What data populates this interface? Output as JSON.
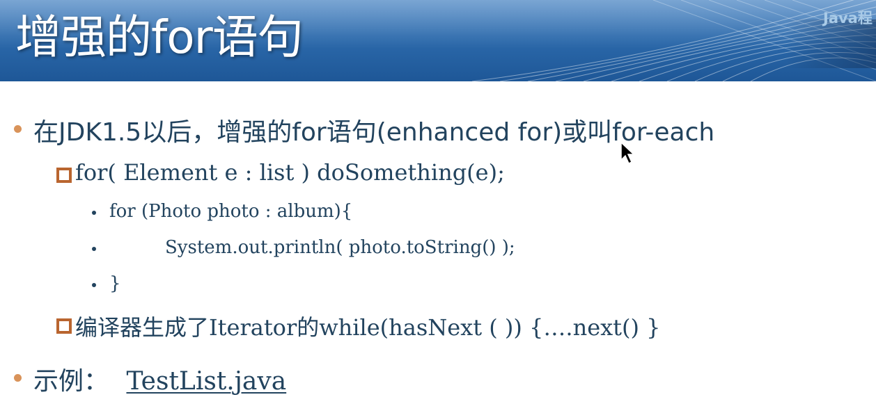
{
  "header": {
    "title": "增强的for语句",
    "brand": "Java程"
  },
  "slide": {
    "bullet1": "在JDK1.5以后，增强的for语句(enhanced for)或叫for-each",
    "sub1": "for( Element e :  list ) doSomething(e);",
    "code_lines": [
      "for (Photo photo : album){",
      "System.out.println( photo.toString() );",
      "}"
    ],
    "sub2": "编译器生成了Iterator的while(hasNext ( )) {….next() }",
    "bullet2_label": "示例：",
    "bullet2_link": "TestList.java"
  },
  "colors": {
    "header_blue": "#2c6aac",
    "text": "#22435e",
    "bullet_orange": "#d9935a",
    "box_brown": "#b9652f"
  },
  "icons": {
    "bullet": "circle-bullet-icon",
    "sub_bullet": "square-bullet-icon",
    "cursor": "mouse-pointer-icon"
  }
}
